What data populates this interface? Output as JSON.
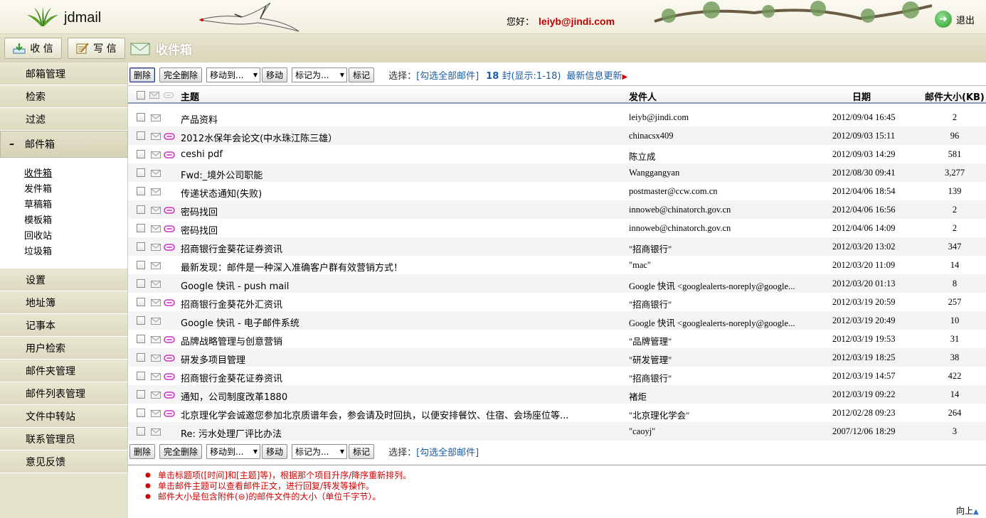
{
  "header": {
    "brand": "jdmail",
    "greeting_label": "您好：",
    "user_email": "leiyb@jindi.com",
    "logout_label": "退出"
  },
  "toolbar": {
    "receive_label": "收 信",
    "compose_label": "写 信",
    "folder_title": "收件箱"
  },
  "sidebar": {
    "items_top": [
      "邮箱管理",
      "检索",
      "过滤"
    ],
    "mailbox_label": "邮件箱",
    "mailbox_toggle": "–",
    "subfolders": [
      "收件箱",
      "发件箱",
      "草稿箱",
      "模板箱",
      "回收站",
      "垃圾箱"
    ],
    "items_bottom": [
      "设置",
      "地址簿",
      "记事本",
      "用户检索",
      "邮件夹管理",
      "邮件列表管理",
      "文件中转站",
      "联系管理员",
      "意见反馈"
    ]
  },
  "actions": {
    "delete": "删除",
    "delete_all": "完全删除",
    "move_to": "移动到...",
    "move": "移动",
    "mark_as": "标记为...",
    "mark": "标记",
    "select_label": "选择：",
    "select_all": "[勾选全部邮件]",
    "count_number": "18",
    "count_text": "封(显示:1-18)",
    "latest": "最新信息更新"
  },
  "table": {
    "col_subject": "主题",
    "col_from": "发件人",
    "col_date": "日期",
    "col_size": "邮件大小(KB)",
    "rows": [
      {
        "subject": "产品资料",
        "from": "leiyb@jindi.com",
        "date": "2012/09/04 16:45",
        "size": "2",
        "attach": false
      },
      {
        "subject": "2012水保年会论文(中水珠江陈三雄）",
        "from": "chinacsx409",
        "date": "2012/09/03 15:11",
        "size": "96",
        "attach": true
      },
      {
        "subject": "ceshi pdf",
        "from": "陈立成",
        "date": "2012/09/03 14:29",
        "size": "581",
        "attach": true
      },
      {
        "subject": "Fwd:_境外公司职能",
        "from": "Wanggangyan",
        "date": "2012/08/30 09:41",
        "size": "3,277",
        "attach": false
      },
      {
        "subject": "传递状态通知(失败)",
        "from": "postmaster@ccw.com.cn",
        "date": "2012/04/06 18:54",
        "size": "139",
        "attach": false
      },
      {
        "subject": "密码找回",
        "from": "innoweb@chinatorch.gov.cn",
        "date": "2012/04/06 16:56",
        "size": "2",
        "attach": true
      },
      {
        "subject": "密码找回",
        "from": "innoweb@chinatorch.gov.cn",
        "date": "2012/04/06 14:09",
        "size": "2",
        "attach": true
      },
      {
        "subject": "招商银行金葵花证券资讯",
        "from": "\"招商银行\"",
        "date": "2012/03/20 13:02",
        "size": "347",
        "attach": true
      },
      {
        "subject": "最新发现：邮件是一种深入准确客户群有效营销方式！",
        "from": "\"mac\"",
        "date": "2012/03/20 11:09",
        "size": "14",
        "attach": false
      },
      {
        "subject": "Google 快讯 - push mail",
        "from": "Google 快讯 <googlealerts-noreply@google...",
        "date": "2012/03/20 01:13",
        "size": "8",
        "attach": false
      },
      {
        "subject": "招商银行金葵花外汇资讯",
        "from": "\"招商银行\"",
        "date": "2012/03/19 20:59",
        "size": "257",
        "attach": true
      },
      {
        "subject": "Google 快讯 - 电子邮件系统",
        "from": "Google 快讯 <googlealerts-noreply@google...",
        "date": "2012/03/19 20:49",
        "size": "10",
        "attach": false
      },
      {
        "subject": "品牌战略管理与创意营销",
        "from": "\"品牌管理\"",
        "date": "2012/03/19 19:53",
        "size": "31",
        "attach": true
      },
      {
        "subject": "研发多项目管理",
        "from": "\"研发管理\"",
        "date": "2012/03/19 18:25",
        "size": "38",
        "attach": true
      },
      {
        "subject": "招商银行金葵花证券资讯",
        "from": "\"招商银行\"",
        "date": "2012/03/19 14:57",
        "size": "422",
        "attach": true
      },
      {
        "subject": "通知，公司制度改革1880",
        "from": "褚炬",
        "date": "2012/03/19 09:22",
        "size": "14",
        "attach": true
      },
      {
        "subject": "北京理化学会诚邀您参加北京质谱年会，参会请及时回执，以便安排餐饮、住宿、会场座位等...",
        "from": "\"北京理化学会\"",
        "date": "2012/02/28 09:23",
        "size": "264",
        "attach": true
      },
      {
        "subject": "Re: 污水处理厂评比办法",
        "from": "\"caoyj\"",
        "date": "2007/12/06 18:29",
        "size": "3",
        "attach": false
      }
    ]
  },
  "tips": [
    "单击标题项([时间]和[主题]等)，根据那个项目升序/降序重新排列。",
    "单击邮件主题可以查看邮件正文，进行回复/转发等操作。",
    "邮件大小是包含附件(⊜)的邮件文件的大小（单位千字节）。"
  ],
  "to_top": "向上",
  "colors": {
    "accent": "#c00000",
    "link": "#1a5da8",
    "attach": "#cc33cc",
    "tips": "#d00000"
  }
}
